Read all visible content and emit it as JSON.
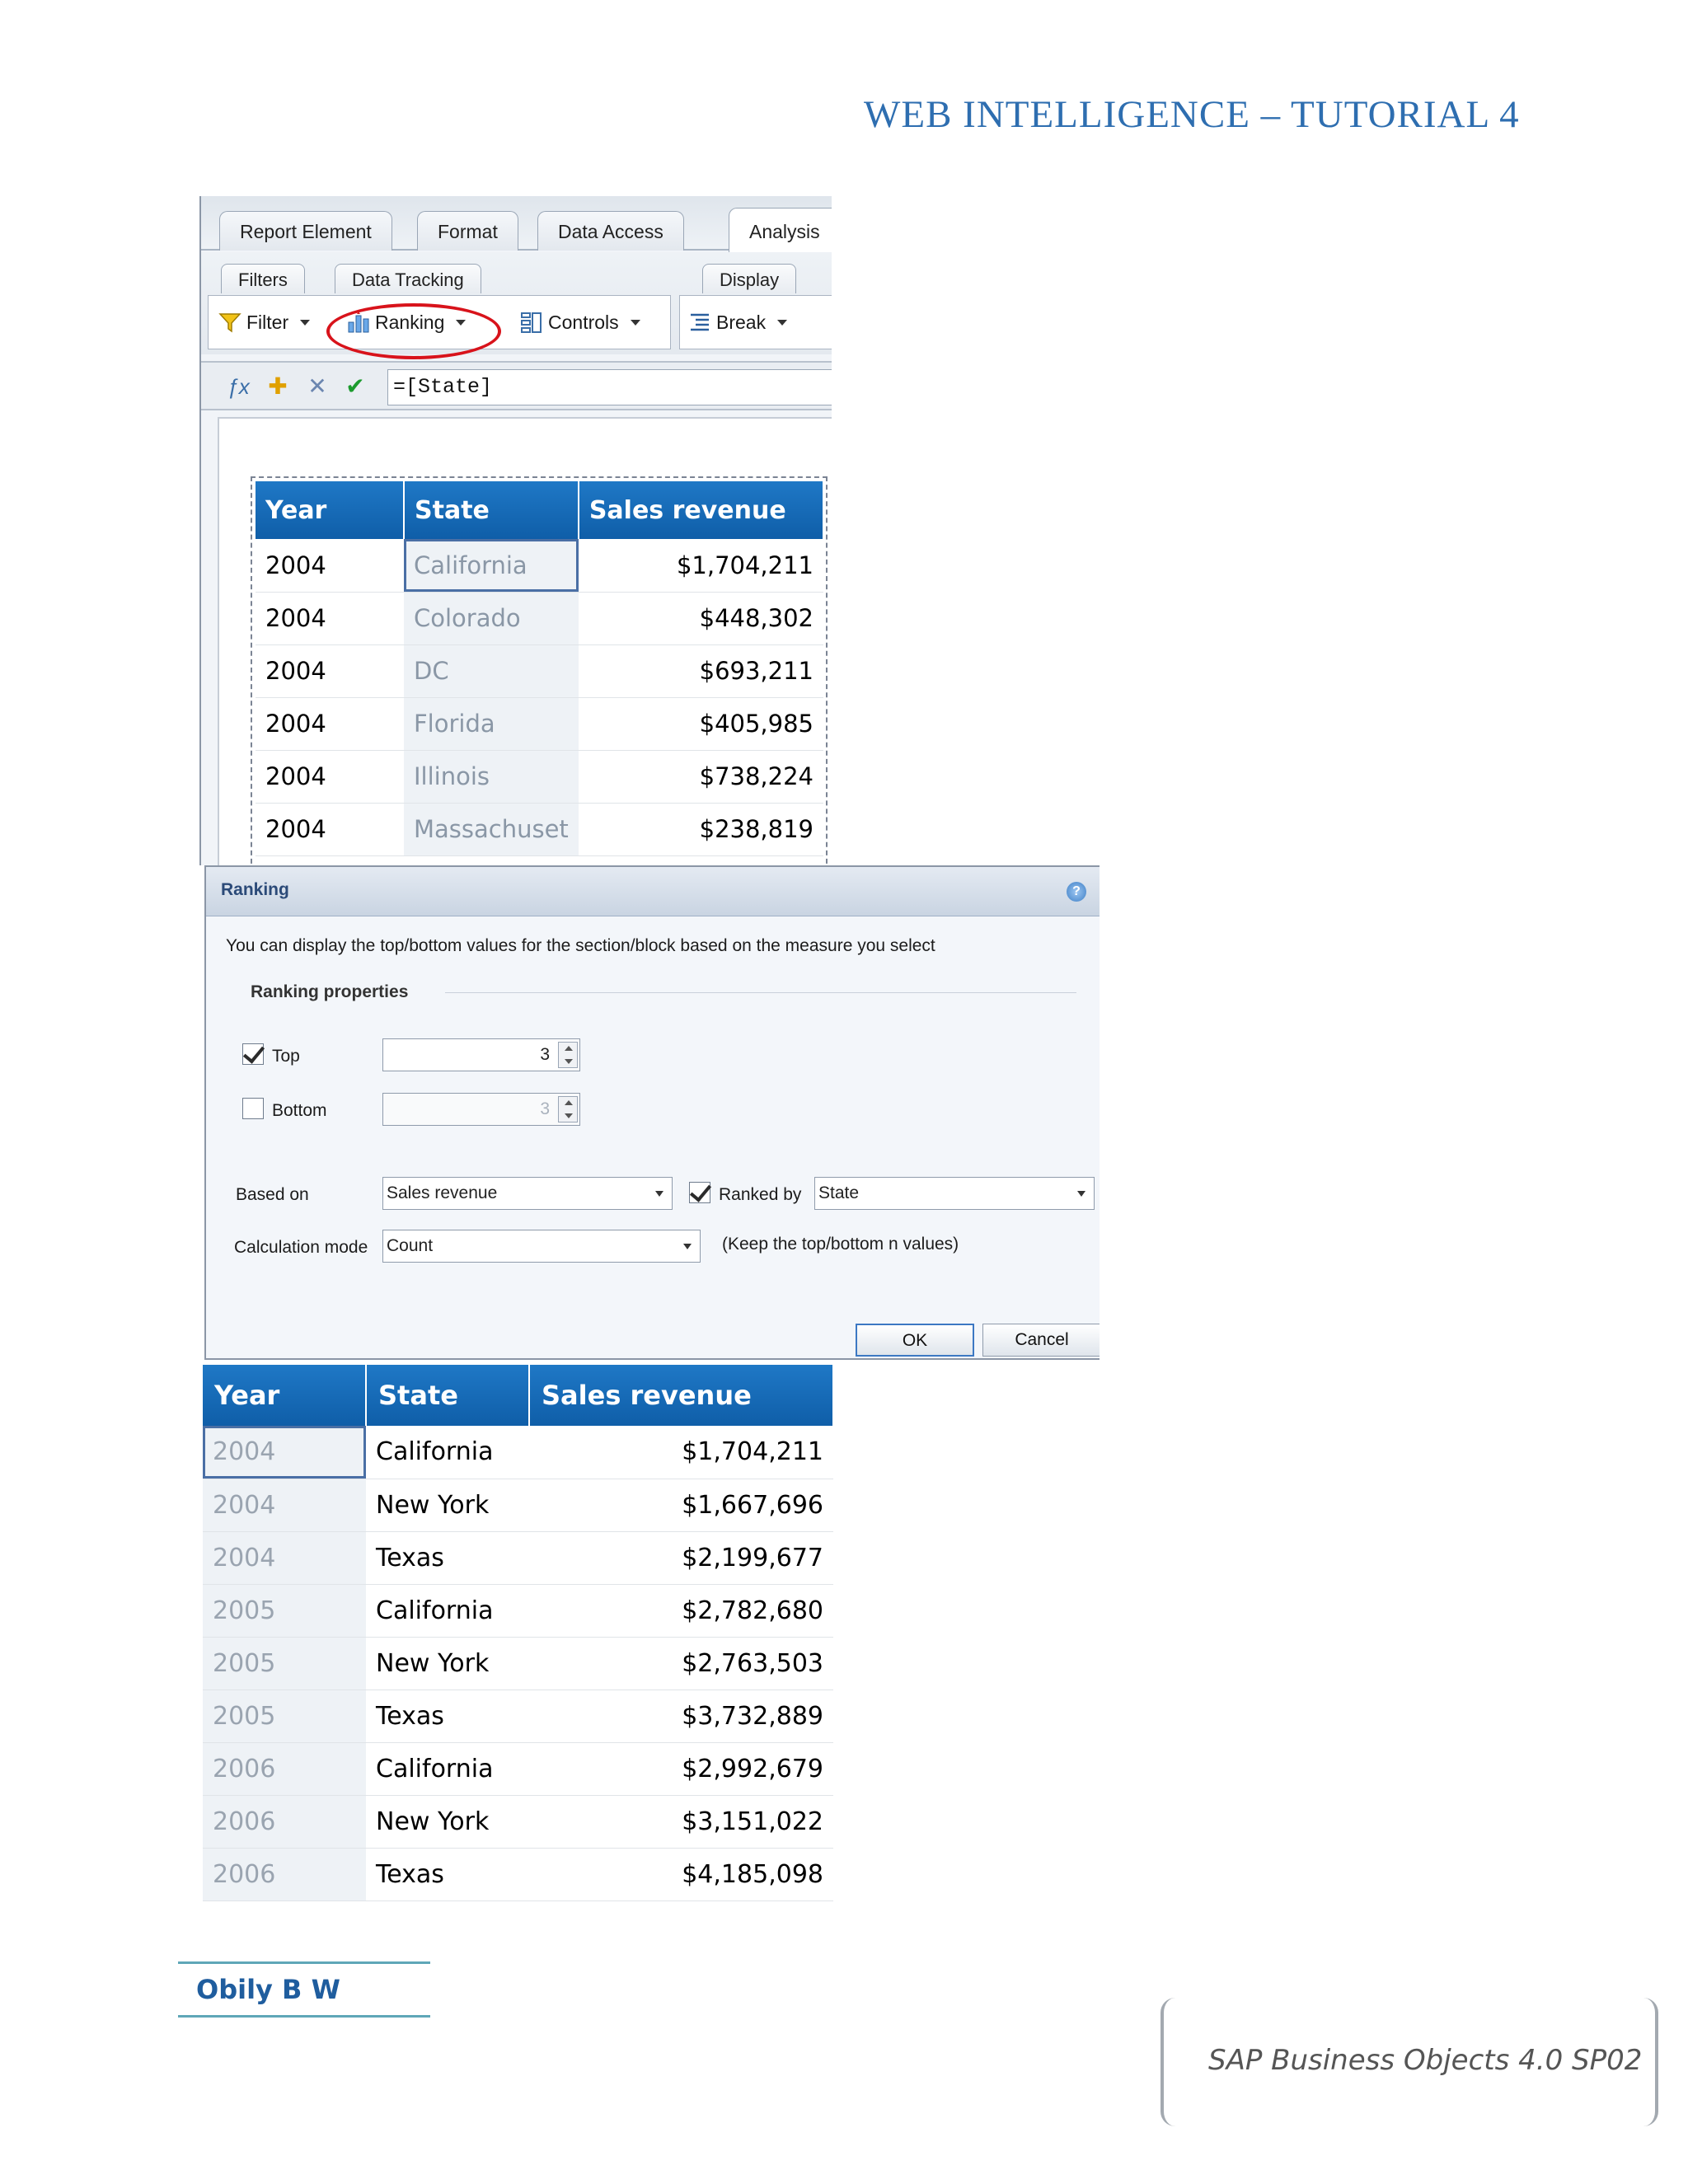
{
  "header": {
    "title": "WEB INTELLIGENCE – TUTORIAL 4"
  },
  "ribbon": {
    "tabs": [
      "Report Element",
      "Format",
      "Data Access",
      "Analysis"
    ],
    "subtabs": [
      "Filters",
      "Data Tracking",
      "Display"
    ],
    "tools": {
      "filter": "Filter",
      "ranking": "Ranking",
      "controls": "Controls",
      "break": "Break"
    }
  },
  "formula": {
    "value": "=[State]"
  },
  "block1": {
    "headers": [
      "Year",
      "State",
      "Sales revenue"
    ],
    "rows": [
      [
        "2004",
        "California",
        "$1,704,211"
      ],
      [
        "2004",
        "Colorado",
        "$448,302"
      ],
      [
        "2004",
        "DC",
        "$693,211"
      ],
      [
        "2004",
        "Florida",
        "$405,985"
      ],
      [
        "2004",
        "Illinois",
        "$738,224"
      ],
      [
        "2004",
        "Massachuset",
        "$238,819"
      ]
    ]
  },
  "dialog": {
    "title": "Ranking",
    "description": "You can display the top/bottom values for the section/block based on the measure you select",
    "section_label": "Ranking properties",
    "top_label": "Top",
    "top_checked": true,
    "top_value": "3",
    "bottom_label": "Bottom",
    "bottom_checked": false,
    "bottom_value": "3",
    "based_on_label": "Based on",
    "based_on_value": "Sales revenue",
    "ranked_by_label": "Ranked by",
    "ranked_by_checked": true,
    "ranked_by_value": "State",
    "calc_mode_label": "Calculation mode",
    "calc_mode_value": "Count",
    "calc_mode_note": "(Keep the top/bottom n values)",
    "ok_label": "OK",
    "cancel_label": "Cancel",
    "help_icon": "?"
  },
  "block2": {
    "headers": [
      "Year",
      "State",
      "Sales revenue"
    ],
    "rows": [
      [
        "2004",
        "California",
        "$1,704,211"
      ],
      [
        "2004",
        "New York",
        "$1,667,696"
      ],
      [
        "2004",
        "Texas",
        "$2,199,677"
      ],
      [
        "2005",
        "California",
        "$2,782,680"
      ],
      [
        "2005",
        "New York",
        "$2,763,503"
      ],
      [
        "2005",
        "Texas",
        "$3,732,889"
      ],
      [
        "2006",
        "California",
        "$2,992,679"
      ],
      [
        "2006",
        "New York",
        "$3,151,022"
      ],
      [
        "2006",
        "Texas",
        "$4,185,098"
      ]
    ]
  },
  "footer": {
    "author": "Obily B W",
    "product": "SAP Business Objects 4.0 SP02"
  },
  "colors": {
    "header_blue": "#2e6eb0",
    "table_header": "#1668b8",
    "ranking_highlight": "#d8131b"
  }
}
